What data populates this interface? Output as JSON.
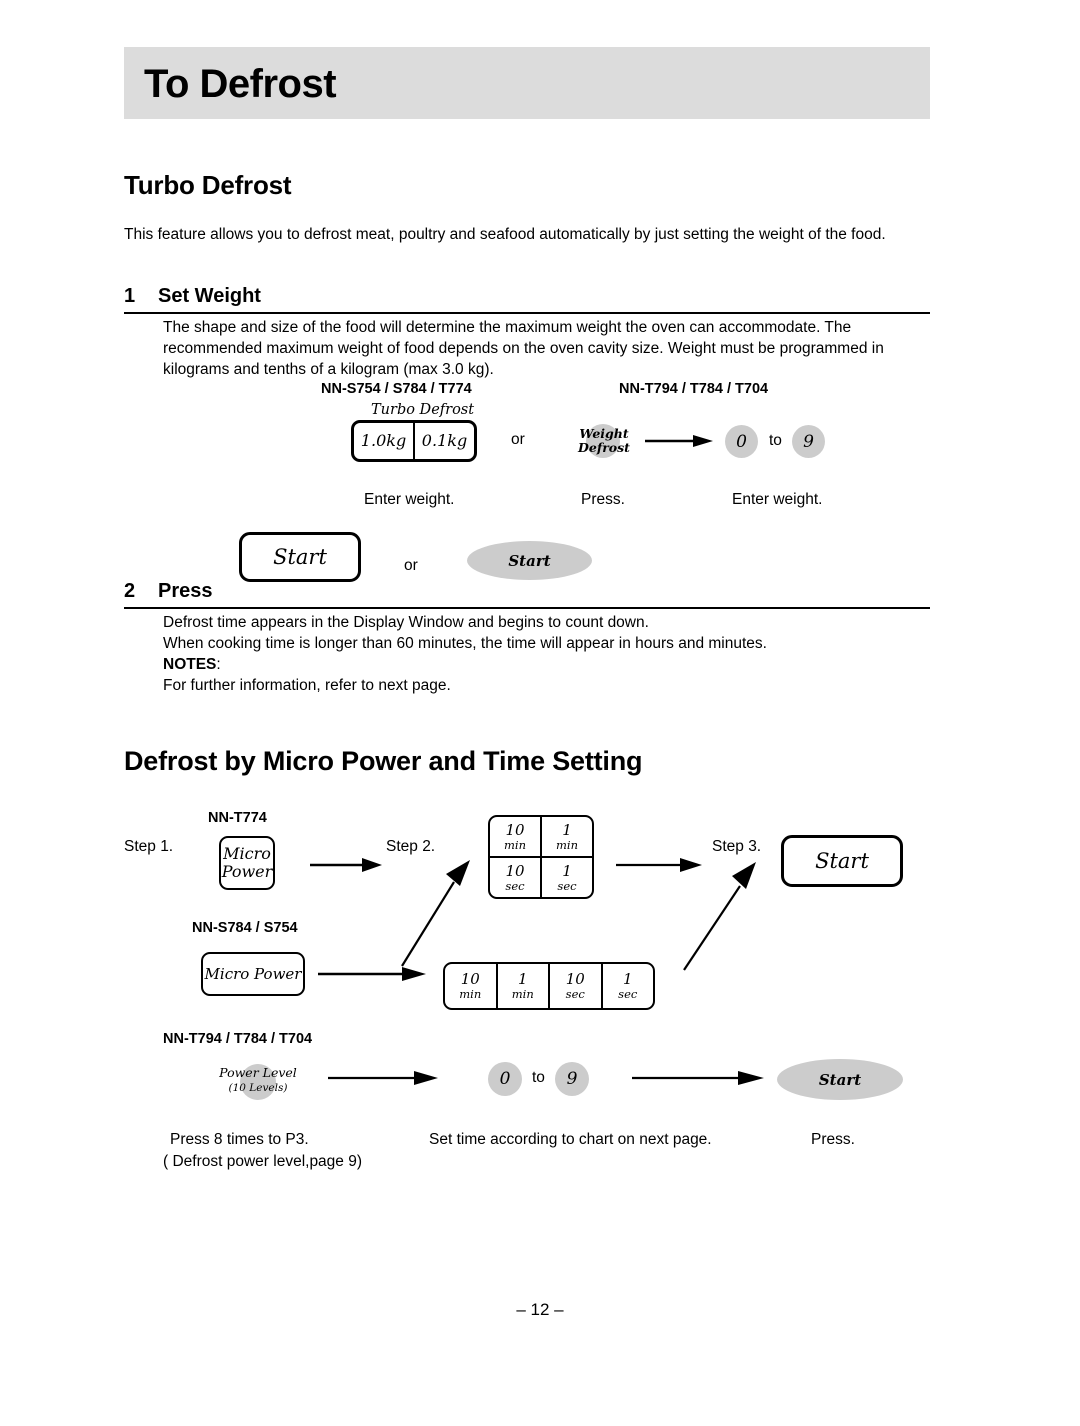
{
  "page": {
    "banner_title": "To Defrost",
    "page_number": "– 12 –"
  },
  "turbo_defrost": {
    "heading": "Turbo Defrost",
    "intro": "This feature allows you to defrost meat, poultry and seafood automatically by just setting the weight of the food.",
    "step1": {
      "number": "1",
      "label": "Set Weight",
      "body": "The shape and size of the food will determine the maximum weight the oven can accommodate. The recommended maximum weight of food depends on the oven cavity size. Weight must be programmed in kilograms and tenths of a kilogram (max 3.0 kg)."
    },
    "diagram": {
      "model_left": "NN-S754 / S784 / T774",
      "model_right": "NN-T794 / T784 / T704",
      "turbo_key_caption": "Turbo Defrost",
      "turbo_key_cells": [
        "1.0kg",
        "0.1kg"
      ],
      "or": "or",
      "weight_defrost_line1": "Weight",
      "weight_defrost_line2": "Defrost",
      "digit_from": "0",
      "digit_to_word": "to",
      "digit_until": "9",
      "caption_left": "Enter weight.",
      "caption_mid": "Press.",
      "caption_right": "Enter weight."
    },
    "start_row": {
      "start_box": "Start",
      "or": "or",
      "start_ellipse": "Start"
    },
    "step2": {
      "number": "2",
      "label": "Press",
      "line1": "Defrost time appears in the Display Window and begins to count down.",
      "line2": "When cooking time is longer than 60 minutes, the time will appear in hours and minutes.",
      "notes_label": "NOTES",
      "notes_colon": ":",
      "notes_body": "For further information, refer to next page."
    }
  },
  "micro_power": {
    "heading": "Defrost by Micro Power and Time Setting",
    "row_t774": {
      "model": "NN-T774",
      "step1_label": "Step 1.",
      "micro_power_line1": "Micro",
      "micro_power_line2": "Power",
      "step2_label": "Step 2.",
      "pad_cells": [
        "10",
        "min",
        "1",
        "min",
        "10",
        "sec",
        "1",
        "sec"
      ],
      "step3_label": "Step 3.",
      "start_box": "Start"
    },
    "row_s784": {
      "model": "NN-S784 / S754",
      "micro_power": "Micro Power",
      "pad_cells": [
        "10",
        "min",
        "1",
        "min",
        "10",
        "sec",
        "1",
        "sec"
      ]
    },
    "row_t794": {
      "model": "NN-T794 / T784 / T704",
      "power_level_line1": "Power Level",
      "power_level_line2": "(10 Levels)",
      "digit_from": "0",
      "digit_to_word": "to",
      "digit_until": "9",
      "start_ellipse": "Start"
    },
    "captions": {
      "left_line1": "Press 8 times to P3.",
      "left_line2": "( Defrost power level,page 9)",
      "mid": "Set time according to chart on next page.",
      "right": "Press."
    }
  },
  "colors": {
    "banner_bg": "#dcdcdc",
    "button_gray": "#cccccc",
    "ink": "#000000"
  }
}
